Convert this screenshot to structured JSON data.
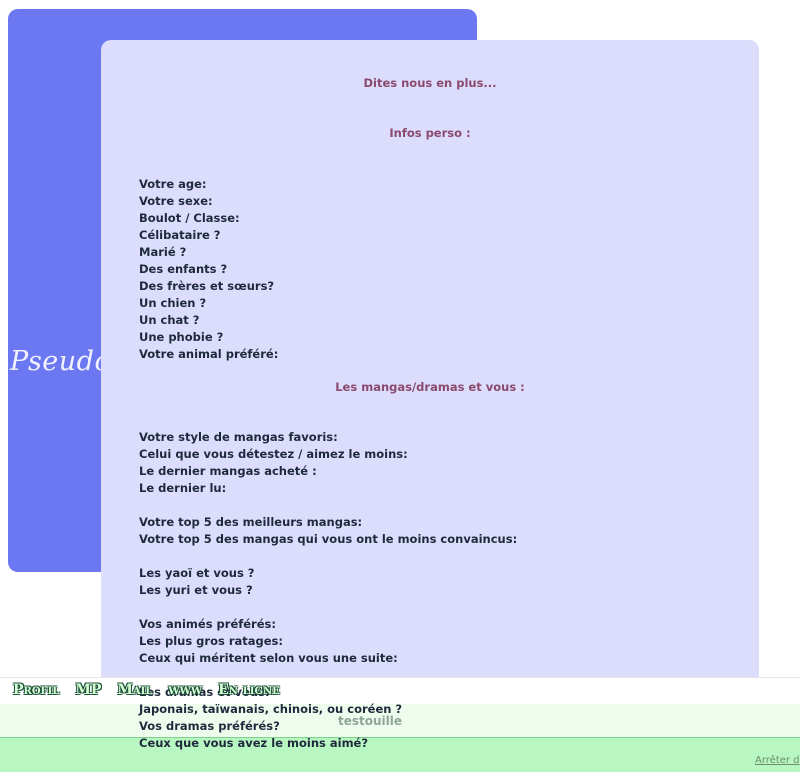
{
  "profile": {
    "pseudo_label": "Pseudo",
    "username": "testouille",
    "links": [
      "Profil",
      "MP",
      "Mail",
      "www",
      "En ligne"
    ]
  },
  "sections": {
    "intro": "Dites nous en plus...",
    "perso_title": "Infos perso :",
    "perso_items": [
      "Votre age:",
      "Votre sexe:",
      "Boulot / Classe:",
      "Célibataire ?",
      "Marié ?",
      "Des enfants ?",
      "Des frères et sœurs?",
      "Un chien ?",
      "Un chat ?",
      "Une phobie ?",
      "Votre animal préféré:"
    ],
    "manga_title": "Les mangas/dramas et vous :",
    "manga_items": [
      "Votre style de mangas favoris:",
      "Celui que vous détestez / aimez le moins:",
      "Le dernier mangas acheté :",
      "Le dernier lu:",
      "",
      "Votre top 5 des meilleurs mangas:",
      "Votre top 5 des mangas qui vous ont le moins convaincus:",
      "",
      "Les yaoï et vous ?",
      "Les yuri et vous ?",
      "",
      "Vos animés préférés:",
      "Les plus gros ratages:",
      "Ceux qui méritent selon vous une suite:"
    ],
    "drama_items": [
      "Les dramas et vous:",
      "Japonais, taïwanais, chinois, ou coréen ?",
      "Vos dramas préférés?",
      "Ceux que vous avez le moins aimé?"
    ]
  },
  "footer": {
    "stop_link": "Arrêter d"
  }
}
